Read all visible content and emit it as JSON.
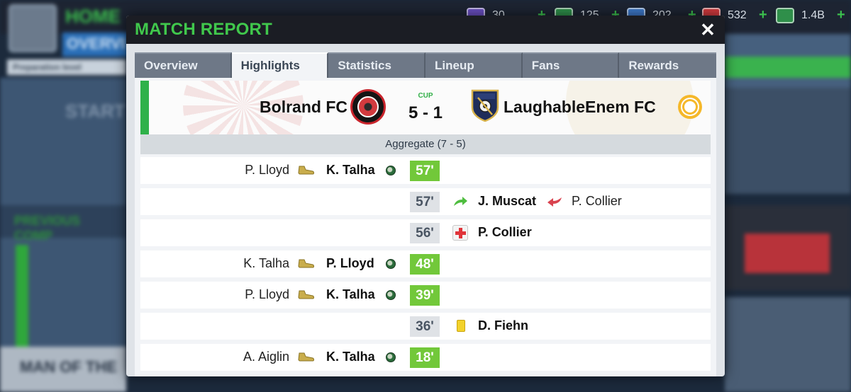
{
  "top_bar": {
    "resources": [
      {
        "icon": "trophy-icon",
        "value": "30"
      },
      {
        "icon": "cash-icon",
        "value": "125"
      },
      {
        "icon": "boost-icon",
        "value": "202"
      },
      {
        "icon": "medical-icon",
        "value": "532"
      },
      {
        "icon": "money-icon",
        "value": "1.4B"
      }
    ]
  },
  "background": {
    "home_label": "HOME",
    "overview_label": "OVERVI",
    "prep_label": "Preparation level",
    "start_label": "START",
    "previous_label": "PREVIOUS COMP",
    "man_label": "MAN OF THE"
  },
  "modal": {
    "title": "MATCH REPORT",
    "close_label": "✕",
    "tabs": [
      {
        "label": "Overview",
        "active": false
      },
      {
        "label": "Highlights",
        "active": true
      },
      {
        "label": "Statistics",
        "active": false
      },
      {
        "label": "Lineup",
        "active": false
      },
      {
        "label": "Fans",
        "active": false
      },
      {
        "label": "Rewards",
        "active": false
      }
    ],
    "match": {
      "home_team": "Bolrand FC",
      "away_team": "LaughableEnem FC",
      "competition": "CUP",
      "score": "5 - 1",
      "aggregate": "Aggregate (7 - 5)",
      "weather_icon": "sun-icon",
      "home_color": "#c9242c",
      "away_color": "#1f2d5a"
    },
    "events": [
      {
        "side": "home",
        "type": "goal",
        "minute": "57'",
        "assist": "P. Lloyd",
        "player": "K. Talha"
      },
      {
        "side": "away",
        "type": "substitution",
        "minute": "57'",
        "player_in": "J. Muscat",
        "player_out": "P. Collier"
      },
      {
        "side": "away",
        "type": "injury",
        "minute": "56'",
        "player": "P. Collier"
      },
      {
        "side": "home",
        "type": "goal",
        "minute": "48'",
        "assist": "K. Talha",
        "player": "P. Lloyd"
      },
      {
        "side": "home",
        "type": "goal",
        "minute": "39'",
        "assist": "P. Lloyd",
        "player": "K. Talha"
      },
      {
        "side": "away",
        "type": "yellow-card",
        "minute": "36'",
        "player": "D. Fiehn"
      },
      {
        "side": "home",
        "type": "goal",
        "minute": "18'",
        "assist": "A. Aiglin",
        "player": "K. Talha"
      }
    ]
  },
  "colors": {
    "accent_green": "#40c84c",
    "minute_goal": "#72c83a",
    "minute_other": "#dfe2e6"
  }
}
